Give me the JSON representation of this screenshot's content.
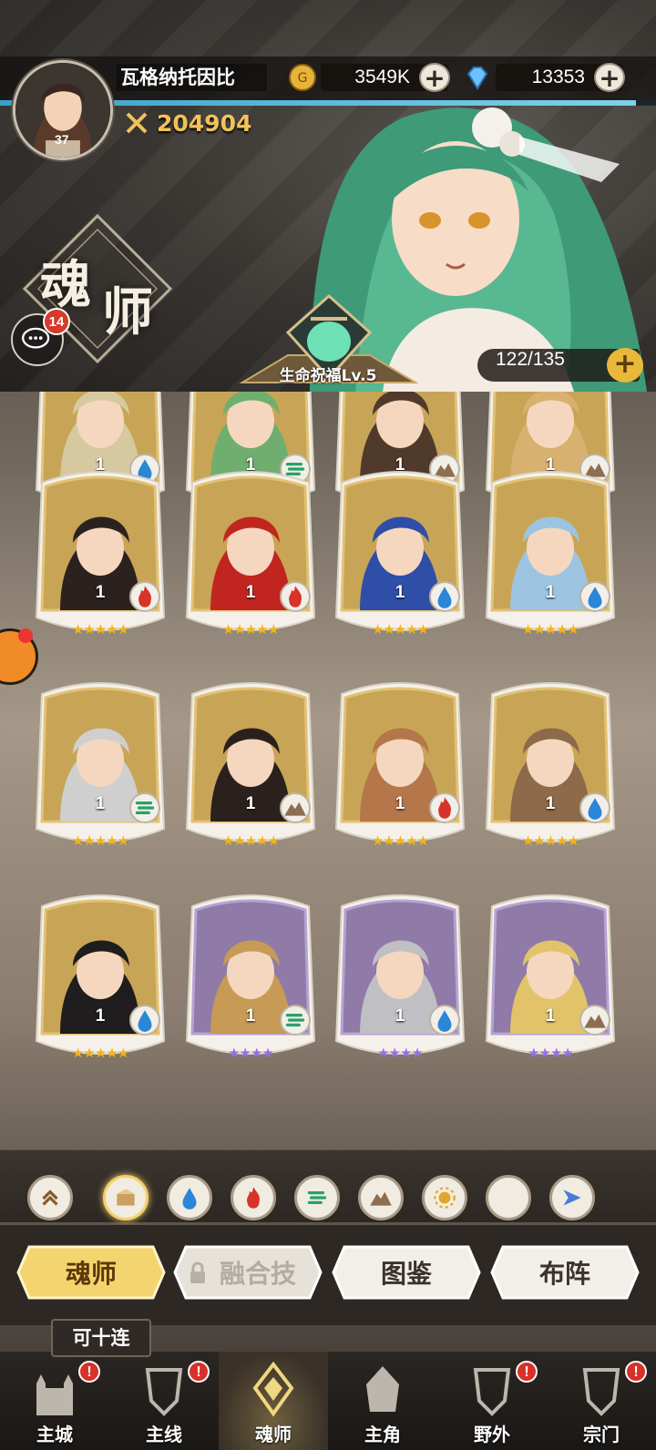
{
  "player": {
    "name": "瓦格纳托因比",
    "level": "37",
    "power": "204904",
    "xp_fraction": 0.97
  },
  "resources": {
    "gold": "3549K",
    "diamonds": "13353"
  },
  "page_title": {
    "char1": "魂",
    "char2": "师"
  },
  "chat": {
    "unread": "14"
  },
  "blessing": {
    "label": "生命祝福Lv.5"
  },
  "capacity": {
    "text": "122/135"
  },
  "cards": [
    {
      "level": "1",
      "stars": "★★★★★",
      "star_color": "#f2b41c",
      "element": "water-icon",
      "frame": "gold"
    },
    {
      "level": "1",
      "stars": "★★★★★",
      "star_color": "#f2b41c",
      "element": "wind-icon",
      "frame": "gold"
    },
    {
      "level": "1",
      "stars": "★★★★★",
      "star_color": "#f2b41c",
      "element": "earth-icon",
      "frame": "gold"
    },
    {
      "level": "1",
      "stars": "★★★★★",
      "star_color": "#f2b41c",
      "element": "earth-icon",
      "frame": "gold"
    },
    {
      "level": "1",
      "stars": "★★★★★",
      "star_color": "#f2b41c",
      "element": "fire-icon",
      "frame": "gold"
    },
    {
      "level": "1",
      "stars": "★★★★★",
      "star_color": "#f2b41c",
      "element": "fire-icon",
      "frame": "gold"
    },
    {
      "level": "1",
      "stars": "★★★★★",
      "star_color": "#f2b41c",
      "element": "water-icon",
      "frame": "gold"
    },
    {
      "level": "1",
      "stars": "★★★★★",
      "star_color": "#f2b41c",
      "element": "water-icon",
      "frame": "gold"
    },
    {
      "level": "1",
      "stars": "★★★★★",
      "star_color": "#f2b41c",
      "element": "wind-icon",
      "frame": "gold"
    },
    {
      "level": "1",
      "stars": "★★★★★",
      "star_color": "#f2b41c",
      "element": "earth-icon",
      "frame": "gold"
    },
    {
      "level": "1",
      "stars": "★★★★★",
      "star_color": "#f2b41c",
      "element": "fire-icon",
      "frame": "gold"
    },
    {
      "level": "1",
      "stars": "★★★★★",
      "star_color": "#f2b41c",
      "element": "water-icon",
      "frame": "gold"
    },
    {
      "level": "1",
      "stars": "★★★★★",
      "star_color": "#f2b41c",
      "element": "water-icon",
      "frame": "gold"
    },
    {
      "level": "1",
      "stars": "★★★★",
      "star_color": "#9a6ee6",
      "element": "wind-icon",
      "frame": "purple"
    },
    {
      "level": "1",
      "stars": "★★★★",
      "star_color": "#9a6ee6",
      "element": "water-icon",
      "frame": "purple"
    },
    {
      "level": "1",
      "stars": "★★★★",
      "star_color": "#9a6ee6",
      "element": "earth-icon",
      "frame": "purple"
    }
  ],
  "filters": [
    "rank-sort-icon",
    "all-chest-icon",
    "water-icon",
    "fire-icon",
    "wind-icon",
    "earth-icon",
    "light-icon",
    "dark-icon",
    "special-icon"
  ],
  "tabs": {
    "soul": "魂师",
    "fusion": "融合技",
    "codex": "图鉴",
    "formation": "布阵"
  },
  "tenpull": "可十连",
  "nav": [
    {
      "label": "主城",
      "badge": "!"
    },
    {
      "label": "主线",
      "badge": "!"
    },
    {
      "label": "魂师",
      "badge": ""
    },
    {
      "label": "主角",
      "badge": ""
    },
    {
      "label": "野外",
      "badge": "!"
    },
    {
      "label": "宗门",
      "badge": "!"
    }
  ],
  "colors": {
    "gold_accent": "#f2c25a",
    "tab_active": "#f4d46e",
    "badge_red": "#d8302a"
  }
}
